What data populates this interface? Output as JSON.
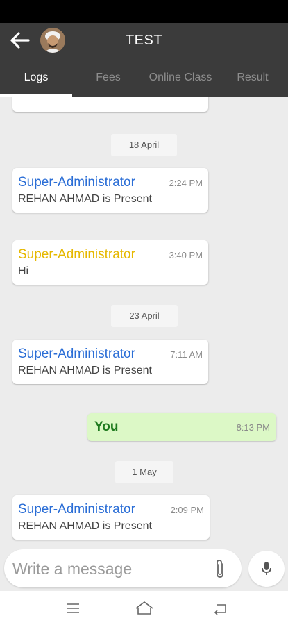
{
  "header": {
    "title": "TEST",
    "icons": [
      "back-arrow-icon",
      "avatar"
    ]
  },
  "tabs": [
    {
      "label": "Logs",
      "active": true
    },
    {
      "label": "Fees",
      "active": false
    },
    {
      "label": "Online Class",
      "active": false
    },
    {
      "label": "Result",
      "active": false
    }
  ],
  "messages": {
    "date_1": "18 April",
    "m1": {
      "sender": "Super-Administrator",
      "time": "2:24 PM",
      "text": "REHAN AHMAD is Present",
      "sender_color": "#2b6ed6"
    },
    "m2": {
      "sender": "Super-Administrator",
      "time": "3:40 PM",
      "text": "Hi",
      "sender_color": "#e6b800"
    },
    "date_2": "23 April",
    "m3": {
      "sender": "Super-Administrator",
      "time": "7:11 AM",
      "text": "REHAN AHMAD is Present",
      "sender_color": "#2b6ed6"
    },
    "m4": {
      "sender": "You",
      "time": "8:13 PM"
    },
    "date_3": "1 May",
    "m5": {
      "sender": "Super-Administrator",
      "time": "2:09 PM",
      "text": "REHAN AHMAD is Present",
      "sender_color": "#2b6ed6"
    }
  },
  "composer": {
    "placeholder": "Write a message",
    "icons": [
      "paperclip-icon",
      "microphone-icon"
    ]
  },
  "nav": {
    "icons": [
      "menu-icon",
      "home-icon",
      "back-icon"
    ]
  },
  "colors": {
    "app_bar": "#3b3b3b",
    "chat_bg": "#ececec",
    "outgoing_bubble": "#dcf8c6",
    "incoming_name_blue": "#2b6ed6",
    "incoming_name_yellow": "#e6b800"
  }
}
